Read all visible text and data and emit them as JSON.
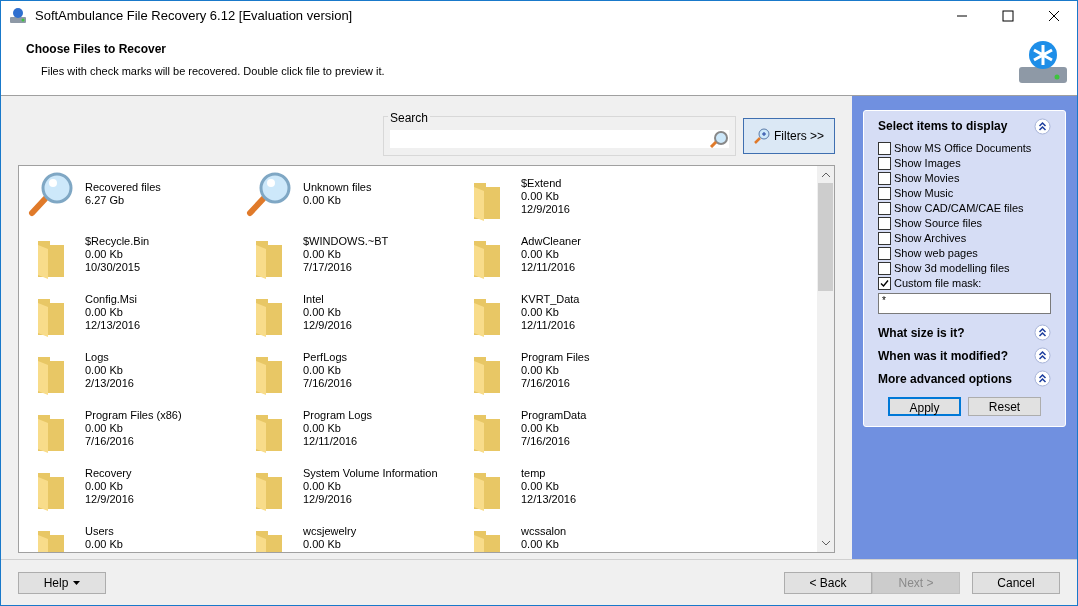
{
  "window": {
    "title": "SoftAmbulance File Recovery 6.12 [Evaluation version]"
  },
  "header": {
    "title": "Choose Files to Recover",
    "subtitle": "Files with check marks will be recovered. Double click file to preview it."
  },
  "search": {
    "label": "Search"
  },
  "filters_button": "Filters >>",
  "files": [
    {
      "kind": "search",
      "name": "Recovered files",
      "size": "6.27 Gb"
    },
    {
      "kind": "search",
      "name": "Unknown files",
      "size": "0.00 Kb"
    },
    {
      "kind": "folder",
      "name": "$Extend",
      "size": "0.00 Kb",
      "date": "12/9/2016"
    },
    {
      "kind": "folder",
      "name": "$Recycle.Bin",
      "size": "0.00 Kb",
      "date": "10/30/2015"
    },
    {
      "kind": "folder",
      "name": "$WINDOWS.~BT",
      "size": "0.00 Kb",
      "date": "7/17/2016"
    },
    {
      "kind": "folder",
      "name": "AdwCleaner",
      "size": "0.00 Kb",
      "date": "12/11/2016"
    },
    {
      "kind": "folder",
      "name": "Config.Msi",
      "size": "0.00 Kb",
      "date": "12/13/2016"
    },
    {
      "kind": "folder",
      "name": "Intel",
      "size": "0.00 Kb",
      "date": "12/9/2016"
    },
    {
      "kind": "folder",
      "name": "KVRT_Data",
      "size": "0.00 Kb",
      "date": "12/11/2016"
    },
    {
      "kind": "folder",
      "name": "Logs",
      "size": "0.00 Kb",
      "date": "2/13/2016"
    },
    {
      "kind": "folder",
      "name": "PerfLogs",
      "size": "0.00 Kb",
      "date": "7/16/2016"
    },
    {
      "kind": "folder",
      "name": "Program Files",
      "size": "0.00 Kb",
      "date": "7/16/2016"
    },
    {
      "kind": "folder",
      "name": "Program Files (x86)",
      "size": "0.00 Kb",
      "date": "7/16/2016"
    },
    {
      "kind": "folder",
      "name": "Program Logs",
      "size": "0.00 Kb",
      "date": "12/11/2016"
    },
    {
      "kind": "folder",
      "name": "ProgramData",
      "size": "0.00 Kb",
      "date": "7/16/2016"
    },
    {
      "kind": "folder",
      "name": "Recovery",
      "size": "0.00 Kb",
      "date": "12/9/2016"
    },
    {
      "kind": "folder",
      "name": "System Volume Information",
      "size": "0.00 Kb",
      "date": "12/9/2016"
    },
    {
      "kind": "folder",
      "name": "temp",
      "size": "0.00 Kb",
      "date": "12/13/2016"
    },
    {
      "kind": "folder",
      "name": "Users",
      "size": "0.00 Kb"
    },
    {
      "kind": "folder",
      "name": "wcsjewelry",
      "size": "0.00 Kb"
    },
    {
      "kind": "folder",
      "name": "wcssalon",
      "size": "0.00 Kb"
    }
  ],
  "filter_panel": {
    "title": "Select items to display",
    "options": [
      {
        "label": "Show MS Office Documents",
        "checked": false
      },
      {
        "label": "Show Images",
        "checked": false
      },
      {
        "label": "Show Movies",
        "checked": false
      },
      {
        "label": "Show Music",
        "checked": false
      },
      {
        "label": "Show CAD/CAM/CAE files",
        "checked": false
      },
      {
        "label": "Show Source files",
        "checked": false
      },
      {
        "label": "Show Archives",
        "checked": false
      },
      {
        "label": "Show web pages",
        "checked": false
      },
      {
        "label": "Show 3d modelling files",
        "checked": false
      },
      {
        "label": "Custom file mask:",
        "checked": true
      }
    ],
    "mask_value": "*",
    "sections": [
      "What size is it?",
      "When was it modified?",
      "More advanced options"
    ],
    "buttons": [
      {
        "label": "Apply",
        "selected": true
      },
      {
        "label": "Reset",
        "selected": false
      }
    ]
  },
  "footer": {
    "help": "Help",
    "back": "< Back",
    "next": {
      "label": "Next >",
      "disabled": true
    },
    "cancel": "Cancel"
  }
}
